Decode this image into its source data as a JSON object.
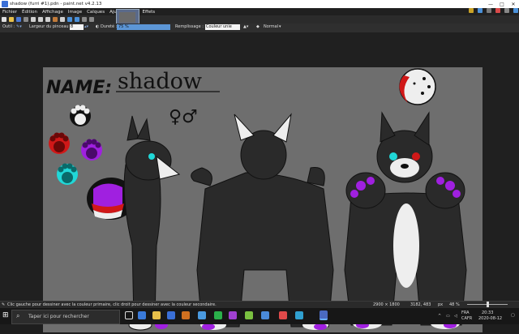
{
  "window": {
    "title": "shadow (furri #1).pdn - paint.net v4.2.13",
    "controls": [
      "—",
      "□",
      "✕"
    ]
  },
  "menu": [
    "Fichier",
    "Édition",
    "Affichage",
    "Image",
    "Calques",
    "Ajustements",
    "Effets"
  ],
  "options": {
    "tool_label": "Outil :",
    "brush_width_label": "Largeur du pinceau :",
    "brush_width_value": "8",
    "hardness_label": "Dureté :",
    "hardness_value": "75 %",
    "fill_label": "Remplissage :",
    "fill_value": "Couleur unie",
    "blend_value": "Normal"
  },
  "artwork": {
    "name_label": "NAME:",
    "name_value": "shadow",
    "gender_symbols": "♀♂"
  },
  "status": {
    "hint": "Clic gauche pour dessiner avec la couleur primaire, clic droit pour dessiner avec la couleur secondaire.",
    "image_size": "2900 × 1800",
    "cursor_pos": "3182, 483",
    "unit": "px",
    "zoom": "48 %"
  },
  "taskbar": {
    "search_placeholder": "Taper ici pour rechercher",
    "language": "FRA",
    "keyboard": "CAFR",
    "time": "20:33",
    "date": "2020-08-12"
  },
  "colors": {
    "canvas_bg": "#6e6e6e",
    "fur_dark": "#2a2a2a",
    "accent_purple": "#a020e0",
    "accent_red": "#d01818",
    "accent_cyan": "#20d8d8"
  }
}
